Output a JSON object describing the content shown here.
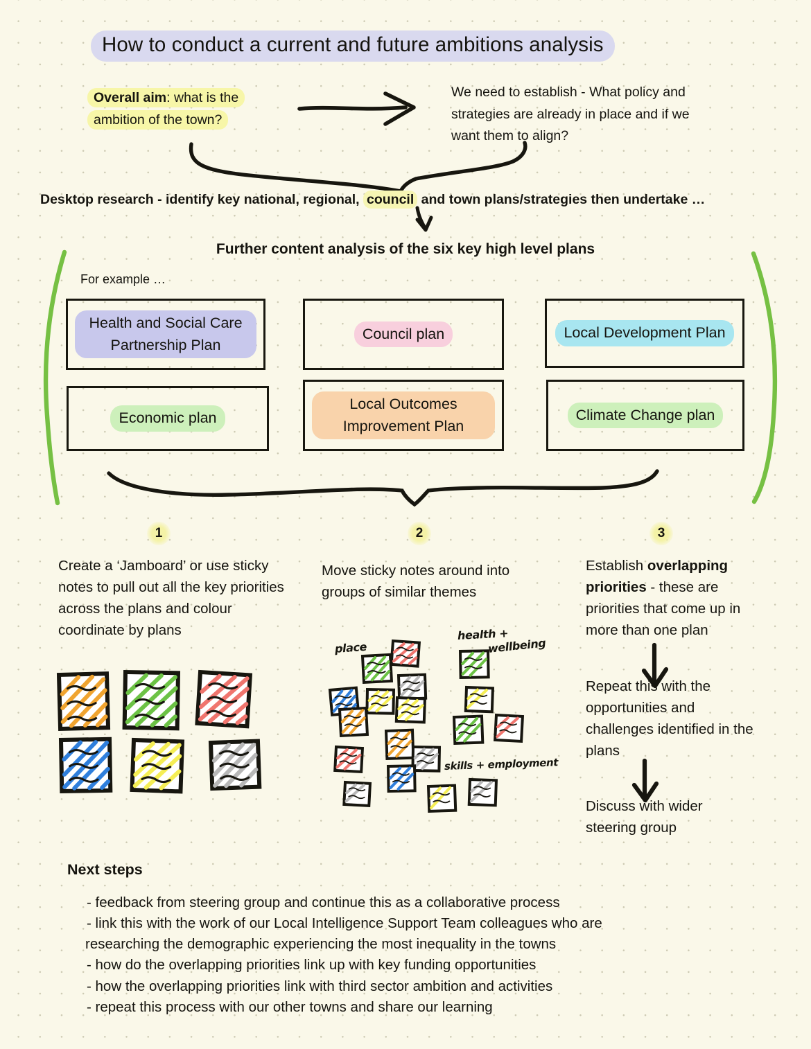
{
  "page": {
    "background_color": "#faf8e9",
    "title": "How to conduct a current and future ambitions analysis",
    "title_highlight_color": "#d9d9ef"
  },
  "top": {
    "aim_bold": "Overall aim",
    "aim_rest": ": what is the ambition of the town?",
    "aim_highlight_color": "#f7f6a8",
    "establish_text": "We need to establish - What policy and strategies are already in place and if we want them to align?"
  },
  "desktop": {
    "part1": "Desktop research - identify key national, regional, ",
    "highlight": "council",
    "part2": " and town plans/strategies then undertake …",
    "highlight_color": "#f6f5b3"
  },
  "further": {
    "heading": "Further content analysis of the six key high level plans",
    "for_example": "For example …",
    "bracket_color": "#76c043"
  },
  "plans": [
    {
      "label": "Health and Social Care Partnership Plan",
      "color": "#c8c8ec",
      "color_name": "purple"
    },
    {
      "label": "Council plan",
      "color": "#f8cfdd",
      "color_name": "pink"
    },
    {
      "label": "Local Development Plan",
      "color": "#a8e6f0",
      "color_name": "cyan"
    },
    {
      "label": "Economic plan",
      "color": "#cdf0bb",
      "color_name": "green"
    },
    {
      "label": "Local Outcomes Improvement Plan",
      "color": "#f9d3ab",
      "color_name": "orange"
    },
    {
      "label": "Climate Change plan",
      "color": "#cdf0bb",
      "color_name": "light-green"
    }
  ],
  "steps": {
    "numbers": [
      "1",
      "2",
      "3"
    ],
    "step1_text": "Create a ‘Jamboard’ or use sticky notes to pull out all the key priorities across the plans and colour coordinate by plans",
    "step2_text": "Move sticky notes around into groups of similar themes",
    "step3_a_pre": "Establish ",
    "step3_a_bold": "overlapping priorities",
    "step3_a_post": " - these are priorities that come up in more than one plan",
    "step3_b": "Repeat this with the opportunities and challenges identified in the plans",
    "step3_c": "Discuss with wider steering group"
  },
  "sticky_notes": {
    "grid_colors": [
      "#f0a430",
      "#6cc245",
      "#f0756e",
      "#2f7fdc",
      "#f5ee55",
      "#b8b8b8"
    ],
    "theme_labels": {
      "place": "place",
      "health_line1": "health +",
      "health_line2": "wellbeing",
      "skills": "skills + employment"
    }
  },
  "next_steps": {
    "heading": "Next steps",
    "items": [
      "- feedback from steering group and continue this as a collaborative process",
      "- link this with the work of our Local Intelligence Support Team colleagues who are",
      "researching the demographic experiencing the most inequality in the towns",
      "- how do the overlapping priorities link up with key funding opportunities",
      "- how the overlapping priorities link with third sector ambition and activities",
      "- repeat this process with our other towns and share our learning"
    ]
  }
}
